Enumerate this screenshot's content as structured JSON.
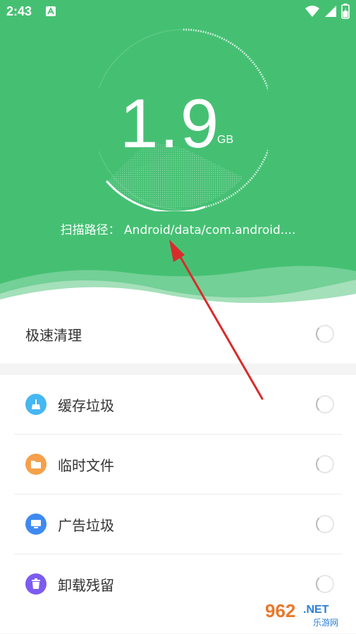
{
  "status_bar": {
    "time": "2:43"
  },
  "scan": {
    "size_value": "1.9",
    "size_unit": "GB",
    "path_label": "扫描路径：",
    "path_value": "Android/data/com.android...."
  },
  "quick_clean": {
    "label": "极速清理"
  },
  "items": [
    {
      "label": "缓存垃圾",
      "icon": "broom-icon",
      "color": "#46b7f2"
    },
    {
      "label": "临时文件",
      "icon": "folder-icon",
      "color": "#f5a04c"
    },
    {
      "label": "广告垃圾",
      "icon": "monitor-icon",
      "color": "#3f8af0"
    },
    {
      "label": "卸载残留",
      "icon": "trash-icon",
      "color": "#7c5cf0"
    }
  ],
  "watermark": {
    "main": "962",
    "suffix": ".NET",
    "sub": "乐游网"
  },
  "colors": {
    "brand_green": "#45c073",
    "text": "#333333"
  }
}
